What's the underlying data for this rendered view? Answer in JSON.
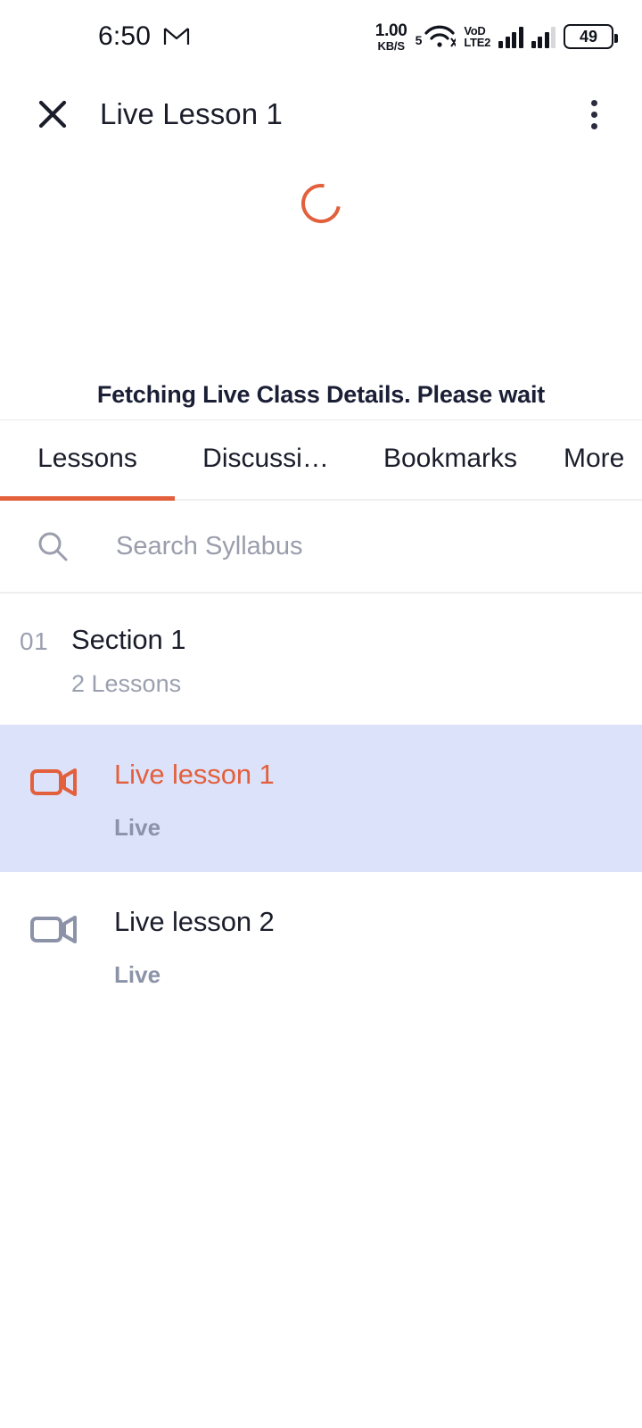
{
  "status_bar": {
    "time": "6:50",
    "gmail_icon": "gmail-icon",
    "net_speed_value": "1.00",
    "net_speed_unit": "KB/S",
    "wifi_label": "5",
    "volte_line1": "VoD",
    "volte_line2": "LTE2",
    "battery_level": "49"
  },
  "app_bar": {
    "close_icon": "close-icon",
    "title": "Live Lesson 1",
    "overflow_icon": "more-vertical-icon"
  },
  "player": {
    "spinner_icon": "loading-spinner-icon",
    "loading_text": "Fetching Live Class Details. Please wait",
    "accent_color": "#e2603c"
  },
  "tabs": {
    "items": [
      {
        "label": "Lessons",
        "active": true
      },
      {
        "label": "Discussi…",
        "active": false
      },
      {
        "label": "Bookmarks",
        "active": false
      },
      {
        "label": "More",
        "active": false
      }
    ],
    "indicator_color": "#e2603c"
  },
  "search": {
    "icon": "search-icon",
    "placeholder": "Search Syllabus"
  },
  "syllabus": {
    "section": {
      "number": "01",
      "title": "Section 1",
      "subtitle": "2 Lessons"
    },
    "lessons": [
      {
        "icon": "video-camera-icon",
        "title": "Live lesson 1",
        "subtitle": "Live",
        "selected": true,
        "title_color": "#e2603c",
        "row_bg": "#dde2fb"
      },
      {
        "icon": "video-camera-icon",
        "title": "Live lesson 2",
        "subtitle": "Live",
        "selected": false,
        "title_color": "#1b1d2b",
        "row_bg": "#ffffff"
      }
    ]
  }
}
